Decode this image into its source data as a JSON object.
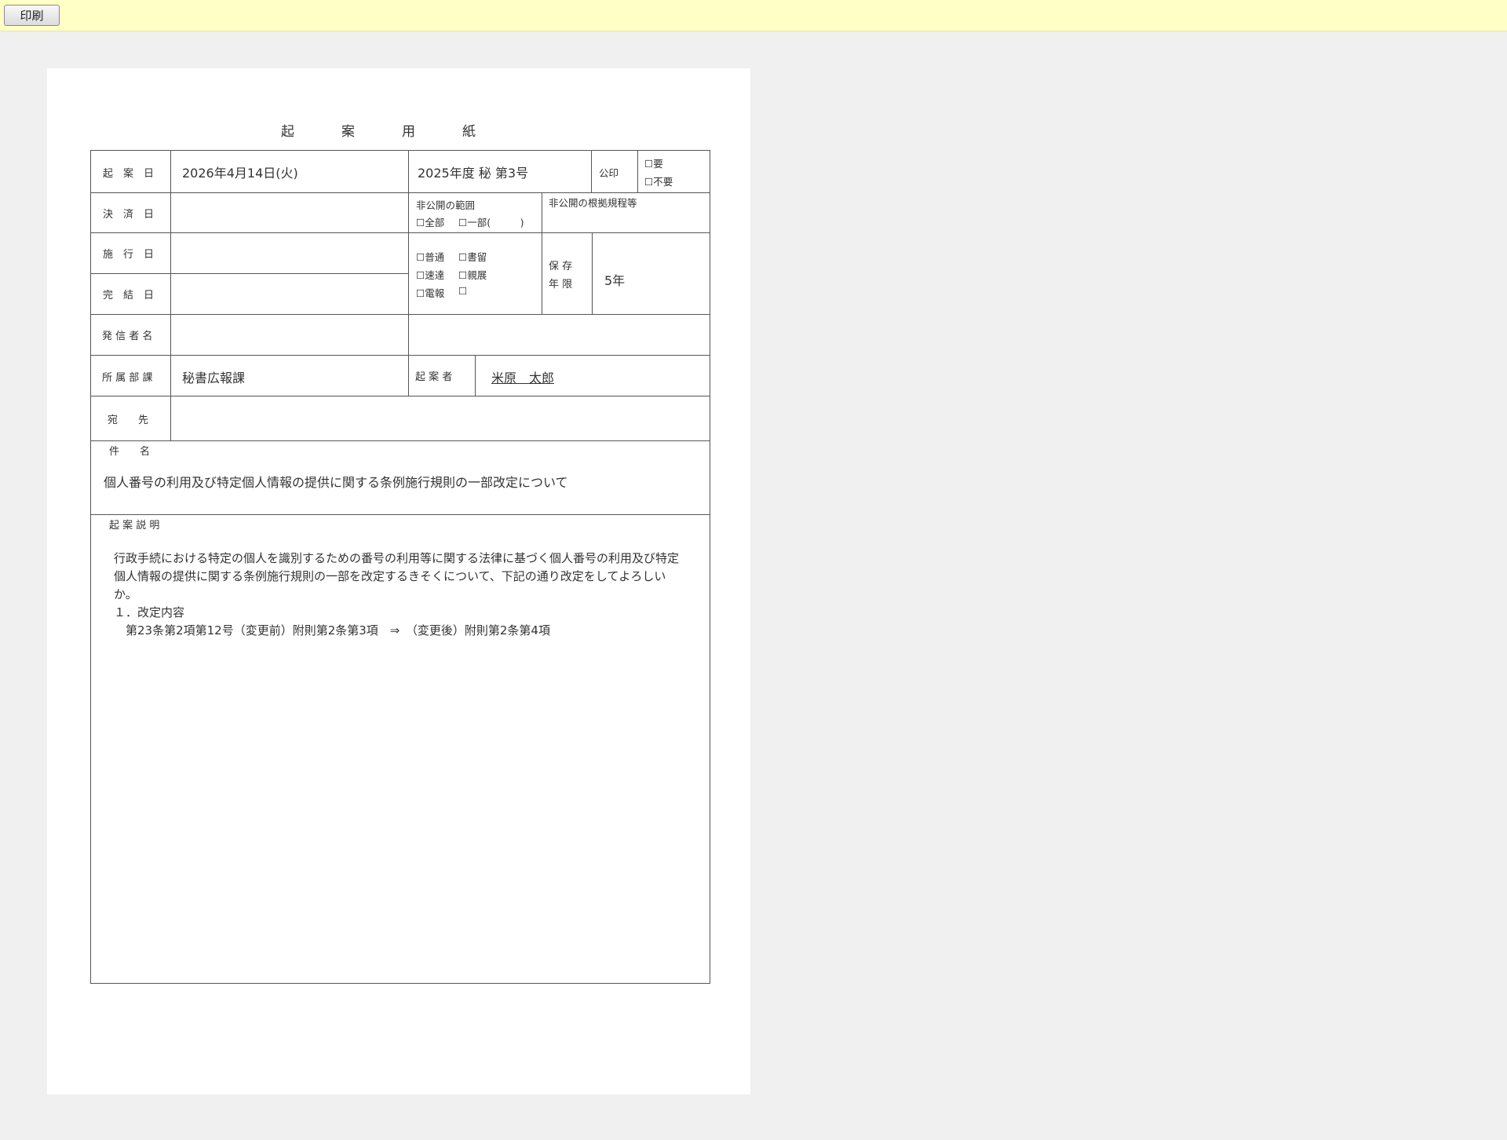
{
  "toolbar": {
    "print_label": "印刷"
  },
  "document": {
    "title": "起案用紙",
    "labels": {
      "draft_date": "起　案　日",
      "decision_date": "決　済　日",
      "enforcement_date": "施　行　日",
      "completion_date": "完　結　日",
      "sender_name": "発 信 者 名",
      "department": "所 属 部 課",
      "drafter": "起 案 者",
      "addressee": "宛　　先",
      "subject": "件　　名",
      "explanation": "起 案 説 明",
      "seal": "公印",
      "nondisclosure_scope": "非公開の範囲",
      "nondisclosure_basis": "非公開の根拠規程等",
      "retention_line1": "保 存",
      "retention_line2": "年 限"
    },
    "values": {
      "draft_date": "2026年4月14日(火)",
      "document_number": "2025年度 秘 第3号",
      "department": "秘書広報課",
      "drafter": "米原　太郎",
      "retention_period": "5年",
      "subject": "個人番号の利用及び特定個人情報の提供に関する条例施行規則の一部改定について"
    },
    "checkboxes": {
      "seal_required": "☐要",
      "seal_not_required": "☐不要",
      "scope_all": "☐全部",
      "scope_partial": "☐一部(　　　)",
      "mail_normal": "☐普通",
      "mail_registered": "☐書留",
      "mail_express": "☐速達",
      "mail_personal": "☐親展",
      "mail_telegram": "☐電報",
      "mail_other": "☐"
    },
    "explanation_lines": [
      "行政手続における特定の個人を識別するための番号の利用等に関する法律に基づく個人番号の利用及び特定",
      "個人情報の提供に関する条例施行規則の一部を改定するきそくについて、下記の通り改定をしてよろしい",
      "か。",
      "１．改定内容",
      "　第23条第2項第12号（変更前）附則第2条第3項　⇒　（変更後）附則第2条第4項"
    ]
  }
}
